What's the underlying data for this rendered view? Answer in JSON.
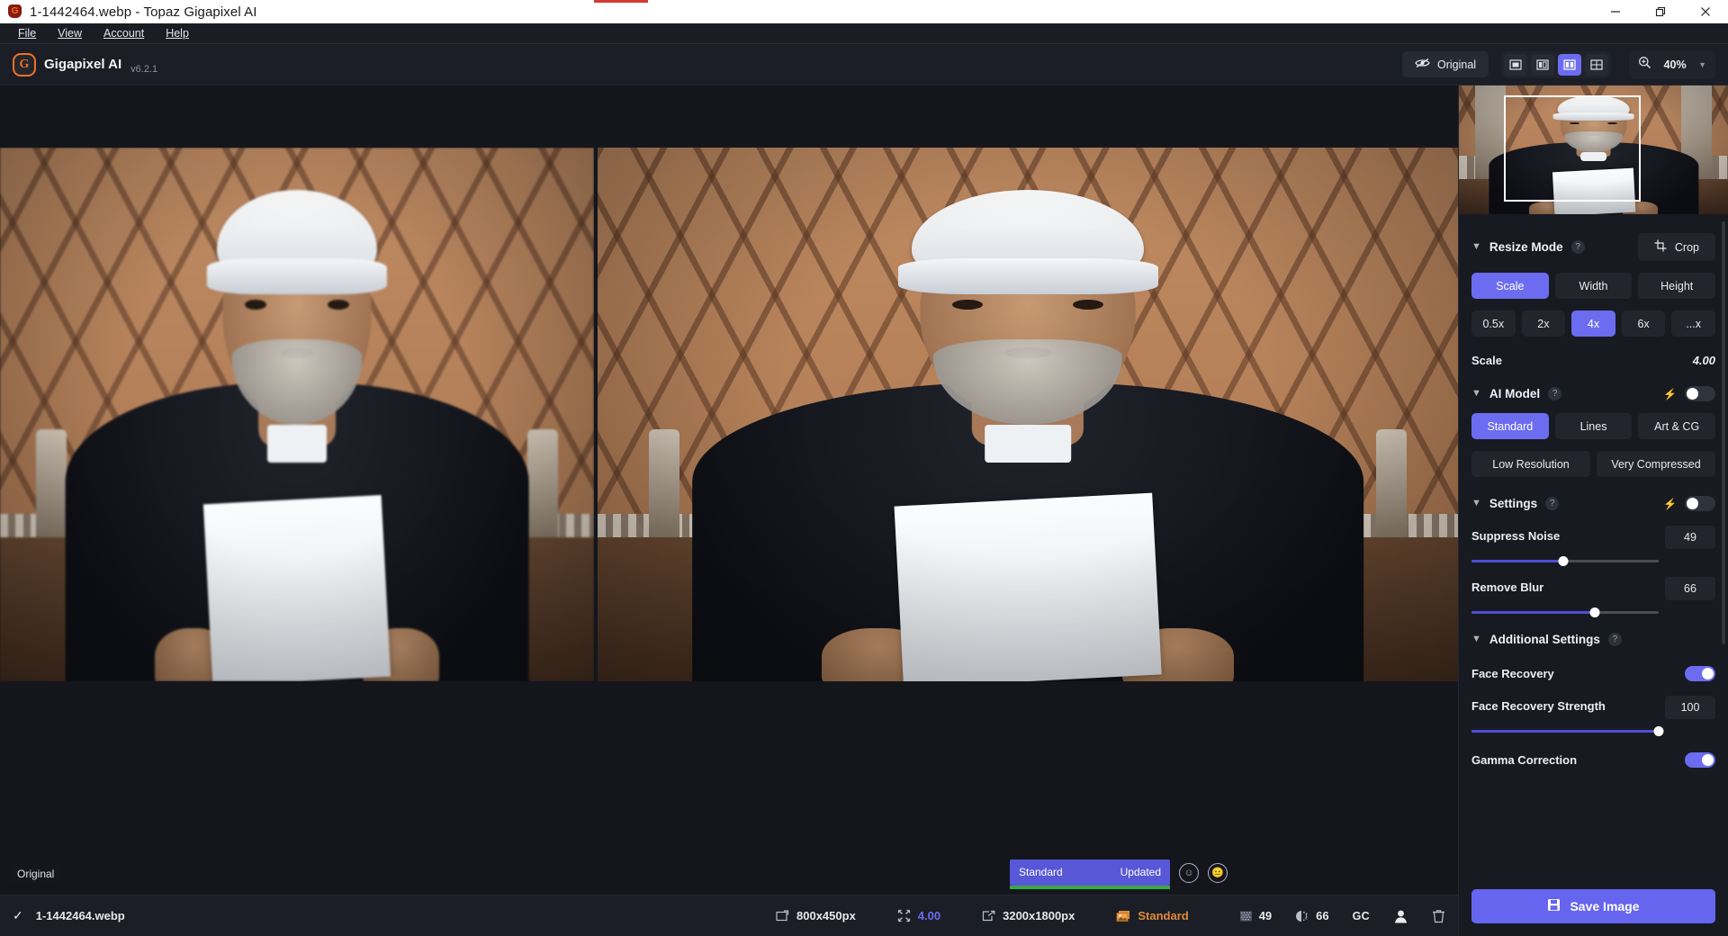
{
  "window": {
    "title": "1-1442464.webp - Topaz Gigapixel AI",
    "app_icon": "topaz-shield-icon",
    "controls": {
      "minimize": "minimize-icon",
      "restore": "restore-icon",
      "close": "close-icon"
    }
  },
  "menu": {
    "items": [
      "File",
      "View",
      "Account",
      "Help"
    ]
  },
  "toolbar": {
    "brand_letter": "G",
    "brand_name": "Gigapixel AI",
    "version": "v6.2.1",
    "original_label": "Original",
    "original_icon": "eye-off-icon",
    "view_modes": [
      {
        "name": "single-view",
        "icon": "single-pane-icon",
        "active": false
      },
      {
        "name": "split-view",
        "icon": "two-pane-icon",
        "active": false
      },
      {
        "name": "side-by-side-view",
        "icon": "side-by-side-icon",
        "active": true
      },
      {
        "name": "grid-view",
        "icon": "grid-pane-icon",
        "active": false
      }
    ],
    "zoom_icon": "magnifier-plus-icon",
    "zoom_value": "40%",
    "zoom_caret": "chevron-down-icon"
  },
  "canvas": {
    "left_label": "Original",
    "process_badge": {
      "model": "Standard",
      "state": "Updated"
    },
    "feedback": {
      "happy_icon": "smiley-happy-icon",
      "neutral_icon": "smiley-neutral-icon"
    }
  },
  "filebar": {
    "check_icon": "checkmark-icon",
    "filename": "1-1442464.webp",
    "input_icon": "image-size-icon",
    "input_size": "800x450px",
    "scale_icon": "arrows-expand-icon",
    "scale_value": "4.00",
    "output_icon": "export-icon",
    "output_size": "3200x1800px",
    "model_icon": "photo-stack-icon",
    "model_name": "Standard",
    "noise_icon": "noise-grid-icon",
    "noise_value": "49",
    "blur_icon": "blur-half-icon",
    "blur_value": "66",
    "gamma_label": "GC",
    "face_icon": "face-recovery-icon",
    "delete_icon": "trash-icon"
  },
  "sidebar": {
    "navigator": {
      "name": "navigator-thumbnail"
    },
    "resize": {
      "title": "Resize Mode",
      "help": "?",
      "chevron": "chevron-down-icon",
      "crop_label": "Crop",
      "crop_icon": "crop-icon",
      "modes": [
        {
          "label": "Scale",
          "active": true
        },
        {
          "label": "Width",
          "active": false
        },
        {
          "label": "Height",
          "active": false
        }
      ],
      "presets": [
        {
          "label": "0.5x",
          "active": false
        },
        {
          "label": "2x",
          "active": false
        },
        {
          "label": "4x",
          "active": true
        },
        {
          "label": "6x",
          "active": false
        },
        {
          "label": "...x",
          "active": false
        }
      ],
      "scale_label": "Scale",
      "scale_value": "4.00"
    },
    "ai_model": {
      "title": "AI Model",
      "help": "?",
      "chevron": "chevron-down-icon",
      "bolt_icon": "lightning-icon",
      "auto_enabled": false,
      "models_row1": [
        {
          "label": "Standard",
          "active": true
        },
        {
          "label": "Lines",
          "active": false
        },
        {
          "label": "Art & CG",
          "active": false
        }
      ],
      "models_row2": [
        {
          "label": "Low Resolution",
          "active": false
        },
        {
          "label": "Very Compressed",
          "active": false
        }
      ]
    },
    "settings": {
      "title": "Settings",
      "help": "?",
      "chevron": "chevron-down-icon",
      "bolt_icon": "lightning-icon",
      "auto_enabled": false,
      "sliders": [
        {
          "label": "Suppress Noise",
          "value": "49",
          "percent": 49
        },
        {
          "label": "Remove Blur",
          "value": "66",
          "percent": 66
        }
      ]
    },
    "additional": {
      "title": "Additional Settings",
      "help": "?",
      "chevron": "chevron-down-icon",
      "face_recovery": {
        "label": "Face Recovery",
        "enabled": true
      },
      "face_strength": {
        "label": "Face Recovery Strength",
        "value": "100",
        "percent": 100
      },
      "gamma": {
        "label": "Gamma Correction",
        "enabled": true
      }
    },
    "save": {
      "label": "Save Image",
      "icon": "save-disk-icon"
    }
  }
}
